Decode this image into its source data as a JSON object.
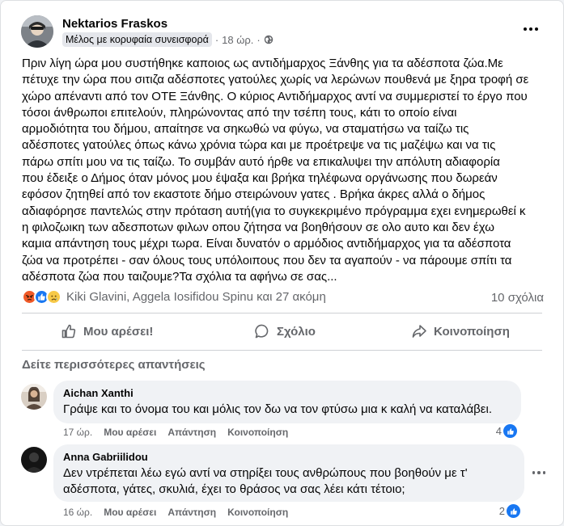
{
  "post": {
    "author": "Nektarios Fraskos",
    "badge": "Μέλος με κορυφαία συνεισφορά",
    "separator": "·",
    "time": "18 ώρ.",
    "dot": "·",
    "text": "Πριν λίγη ώρα μου συστήθηκε καποιος ως αντιδήμαρχος  Ξάνθης για τα αδέσποτα ζώα.Με\nπέτυχε την ώρα που σιτιζα αδέσποτες γατούλες χωρίς να λερώνων πουθενά με ξηρα τροφή σε\nχώρο απέναντι από τον ΟΤΕ Ξάνθης. Ο κύριος Αντιδήμαρχος αντί να συμμεριστεί το έργο που\nτόσοι άνθρωποι επιτελούν, πληρώνοντας από την τσέπη τους, κάτι το οποίο είναι\nαρμοδιότητα του δήμου, απαίτησε να σηκωθώ να φύγω, να σταματήσω να ταίζω τις\nαδέσποτες γατούλες όπως κάνω χρόνια τώρα και με προέτρεψε να τις μαζέψω και να τις\nπάρω σπίτι μου να τις ταίζω. Το συμβάν  αυτό ήρθε να επικαλυψει την απόλυτη αδιαφορία\nπου έδειξε ο Δήμος όταν μόνος μου έψαξα και βρήκα τηλέφωνα οργάνωσης που δωρεάν\nεφόσον ζητηθεί από τον εκαστοτε δήμο στειρώνουν γατες . Βρήκα άκρες αλλά ο δήμος\nαδιαφόρησε παντελώς στην πρόταση αυτή(για το συγκεκριμένο πρόγραμμα εχει ενημερωθεί κ\nη φιλοζωικη των αδεσποτων φιλων οπου ζήτησα να βοηθήσουν σε ολο αυτο και δεν έχω\nκαμια απάντηση τους μέχρι τωρα. Είναι δυνατόν ο αρμόδιος αντιδήμαρχος για τα αδέσποτα\nζώα να προτρέπει - σαν όλους τους υπόλοιπους που δεν τα αγαπούν - να πάρουμε σπίτι τα\nαδέσποτα ζώα που ταιζουμε?Τα σχόλια τα αφήνω σε σας...",
    "reaction_names": "Kiki Glavini, Aggela Iosifidou Spinu και 27 ακόμη",
    "comments_count": "10 σχόλια",
    "reaction_icons": [
      "angry-icon",
      "like-icon",
      "sad-icon"
    ]
  },
  "actions": {
    "like": "Μου αρέσει!",
    "comment": "Σχόλιο",
    "share": "Κοινοποίηση"
  },
  "see_more": "Δείτε περισσότερες απαντήσεις",
  "comments": [
    {
      "name": "Aichan Xanthi",
      "text": "Γράψε και το όνομα του και μόλις τον δω να τον φτύσω μια κ καλή να καταλάβει.",
      "time": "17 ώρ.",
      "like": "Μου αρέσει",
      "reply": "Απάντηση",
      "share": "Κοινοποίηση",
      "likes": "4"
    },
    {
      "name": "Anna Gabriilidou",
      "text": "Δεν ντρέπεται λέω εγώ αντί να στηρίξει τους ανθρώπους που βοηθούν με τ'\nαδέσποτα, γάτες, σκυλιά, έχει το θράσος να σας λέει κάτι τέτοιο;",
      "time": "16 ώρ.",
      "like": "Μου αρέσει",
      "reply": "Απάντηση",
      "share": "Κοινοποίηση",
      "likes": "2"
    }
  ],
  "colors": {
    "brand_blue": "#1877f2",
    "secondary_text": "#65676b",
    "bubble_bg": "#f0f2f5"
  }
}
